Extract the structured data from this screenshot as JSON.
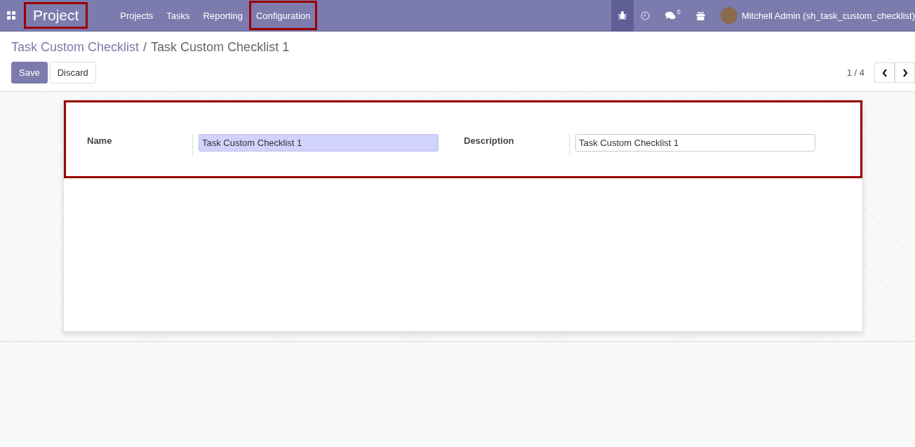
{
  "navbar": {
    "app_name": "Project",
    "app_highlighted": true,
    "menu": [
      {
        "label": "Projects",
        "highlighted": false
      },
      {
        "label": "Tasks",
        "highlighted": false
      },
      {
        "label": "Reporting",
        "highlighted": false
      },
      {
        "label": "Configuration",
        "highlighted": true
      }
    ],
    "debug_active": true,
    "messages_count": "5",
    "user": "Mitchell Admin (sh_task_custom_checklist)"
  },
  "breadcrumb": {
    "parent": "Task Custom Checklist",
    "separator": "/",
    "current": "Task Custom Checklist 1"
  },
  "buttons": [
    {
      "label": "Save",
      "kind": "primary"
    },
    {
      "label": "Discard",
      "kind": "secondary"
    }
  ],
  "pager": "1 / 4",
  "form": {
    "highlighted": true,
    "fields": [
      {
        "label": "Name",
        "value": "Task Custom Checklist 1",
        "focused": true
      },
      {
        "label": "Description",
        "value": "Task Custom Checklist 1",
        "focused": false
      }
    ]
  }
}
